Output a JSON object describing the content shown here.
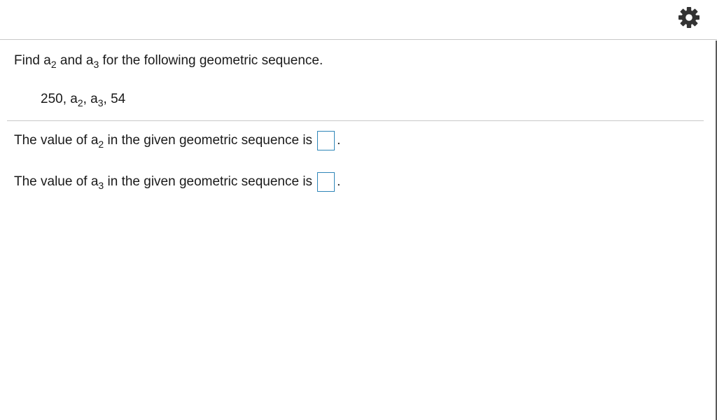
{
  "header": {
    "settings_icon": "gear-icon"
  },
  "question": {
    "prefix": "Find a",
    "sub1": "2",
    "mid": " and a",
    "sub2": "3",
    "suffix": " for the following geometric sequence."
  },
  "sequence": {
    "first": "250, a",
    "sub1": "2",
    "sep": ", a",
    "sub2": "3",
    "last": ", 54"
  },
  "answers": [
    {
      "prefix": "The value of a",
      "sub": "2",
      "suffix": " in the given geometric sequence is",
      "value": "",
      "period": "."
    },
    {
      "prefix": "The value of a",
      "sub": "3",
      "suffix": " in the given geometric sequence is",
      "value": "",
      "period": "."
    }
  ],
  "colors": {
    "input_border": "#2f86b8",
    "divider": "#c8c8c8",
    "text": "#1a1a1a"
  }
}
